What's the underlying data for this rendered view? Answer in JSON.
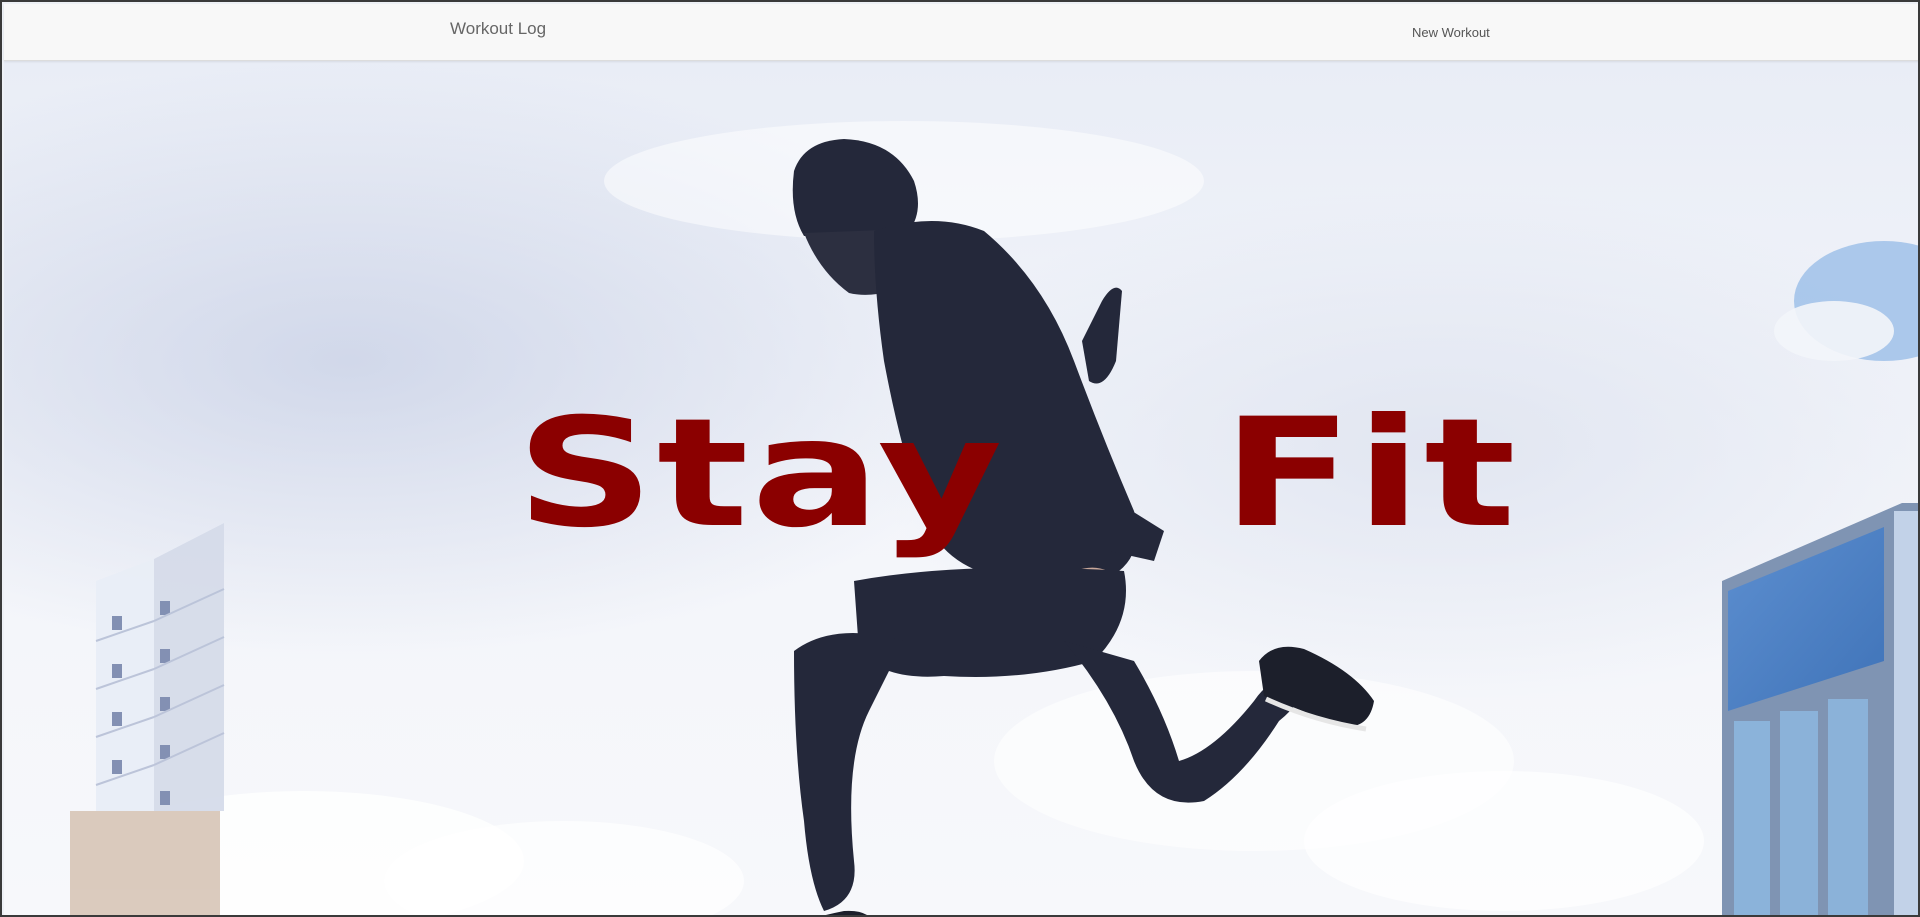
{
  "navbar": {
    "brand": "Workout Log",
    "new_workout_label": "New Workout"
  },
  "hero": {
    "title_word_1": "Stay",
    "title_word_2": "Fit",
    "image_subject": "person jumping against cloudy sky between buildings"
  },
  "colors": {
    "title": "#8b0000",
    "navbar_bg": "#f8f8f8",
    "navbar_text": "#666666"
  }
}
